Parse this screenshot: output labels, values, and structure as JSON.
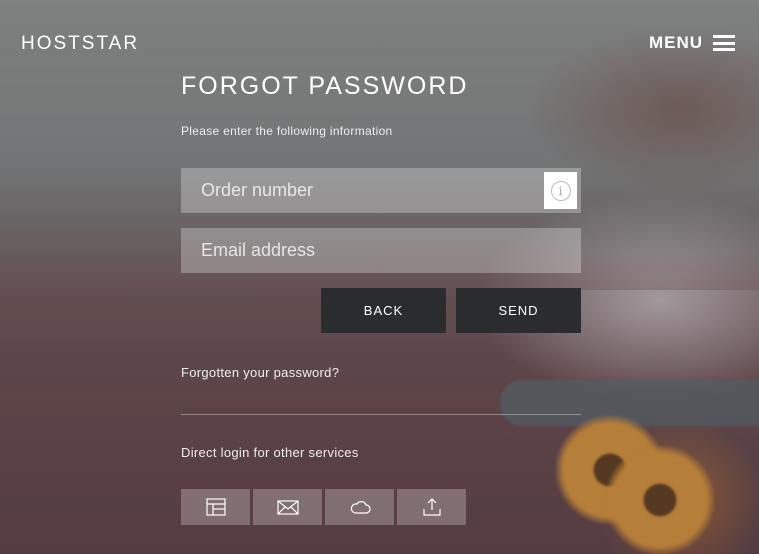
{
  "header": {
    "logo": "HOSTSTAR",
    "menu_label": "MENU"
  },
  "form": {
    "title": "FORGOT PASSWORD",
    "subtitle": "Please enter the following information",
    "order_placeholder": "Order number",
    "order_value": "",
    "email_placeholder": "Email address",
    "email_value": "",
    "info_icon": "i",
    "back_label": "BACK",
    "send_label": "SEND"
  },
  "links": {
    "forgot": "Forgotten your password?"
  },
  "services": {
    "label": "Direct login for other services",
    "items": [
      {
        "icon": "layout-icon"
      },
      {
        "icon": "mail-icon"
      },
      {
        "icon": "cloud-icon"
      },
      {
        "icon": "upload-icon"
      }
    ]
  },
  "colors": {
    "button_bg": "#2b2c2e",
    "text": "#ffffff"
  }
}
